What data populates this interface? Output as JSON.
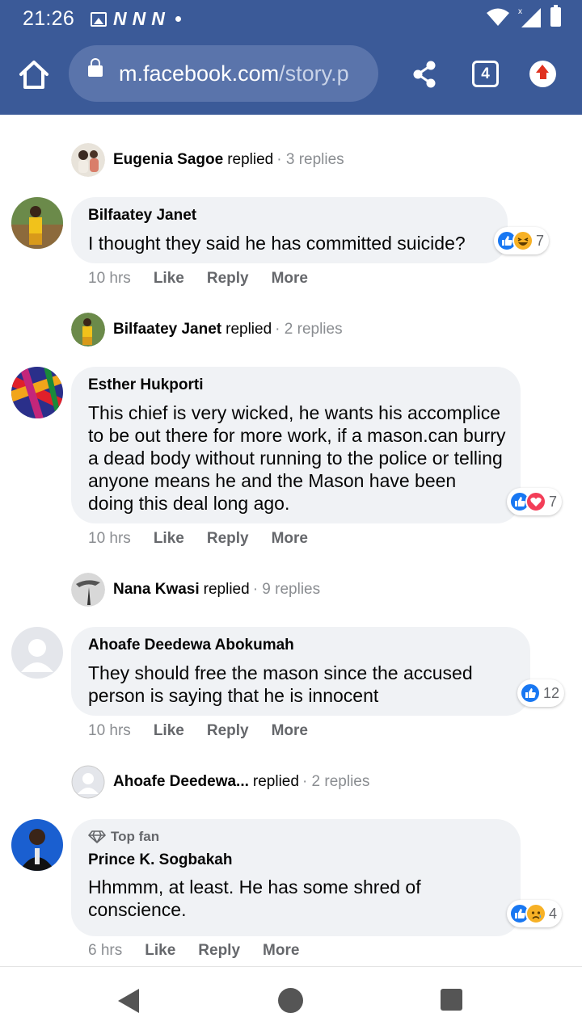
{
  "status_bar": {
    "time": "21:26",
    "icons": [
      "image-icon",
      "n-icon",
      "n-icon",
      "n-icon",
      "dot-icon",
      "wifi-icon",
      "signal-icon",
      "battery-icon"
    ],
    "n_letter": "N"
  },
  "browser": {
    "url_host": "m.facebook.com",
    "url_path": "/story.p",
    "tab_count": "4",
    "colors": {
      "toolbar": "#3b5a98",
      "pill": "#5a74ab"
    }
  },
  "threads": [
    {
      "reply_summary": {
        "name": "Eugenia Sagoe",
        "verb": "replied",
        "count": "· 3 replies"
      }
    },
    {
      "name": "Bilfaatey Janet",
      "text": "I thought they said he has committed suicide?",
      "reactions": [
        "like",
        "haha"
      ],
      "reaction_count": "7",
      "time": "10 hrs",
      "actions": [
        "Like",
        "Reply",
        "More"
      ],
      "reply_summary": {
        "name": "Bilfaatey Janet",
        "verb": "replied",
        "count": "· 2 replies"
      }
    },
    {
      "name": "Esther Hukporti",
      "text": "This chief is very wicked, he wants his accomplice to be out there for more work, if a mason.can burry a dead body without running to the police or telling anyone means he and the Mason have been doing this deal long ago.",
      "reactions": [
        "like",
        "love"
      ],
      "reaction_count": "7",
      "time": "10 hrs",
      "actions": [
        "Like",
        "Reply",
        "More"
      ],
      "reply_summary": {
        "name": "Nana Kwasi",
        "verb": "replied",
        "count": "· 9 replies"
      }
    },
    {
      "name": "Ahoafe Deedewa Abokumah",
      "text": "They should free the mason since the accused person is saying that he is innocent",
      "reactions": [
        "like"
      ],
      "reaction_count": "12",
      "time": "10 hrs",
      "actions": [
        "Like",
        "Reply",
        "More"
      ],
      "reply_summary": {
        "name": "Ahoafe Deedewa...",
        "verb": "replied",
        "count": "· 2 replies"
      }
    },
    {
      "badge": "Top fan",
      "name": "Prince K. Sogbakah",
      "text": "Hhmmm, at least. He has some shred of conscience.",
      "reactions": [
        "like",
        "sad"
      ],
      "reaction_count": "4",
      "time": "6 hrs",
      "actions": [
        "Like",
        "Reply",
        "More"
      ]
    }
  ],
  "colors": {
    "bubble": "#f0f2f5",
    "like": "#1877f2",
    "love": "#f33e58",
    "haha": "#f7b125",
    "meta_text": "#65676b"
  }
}
